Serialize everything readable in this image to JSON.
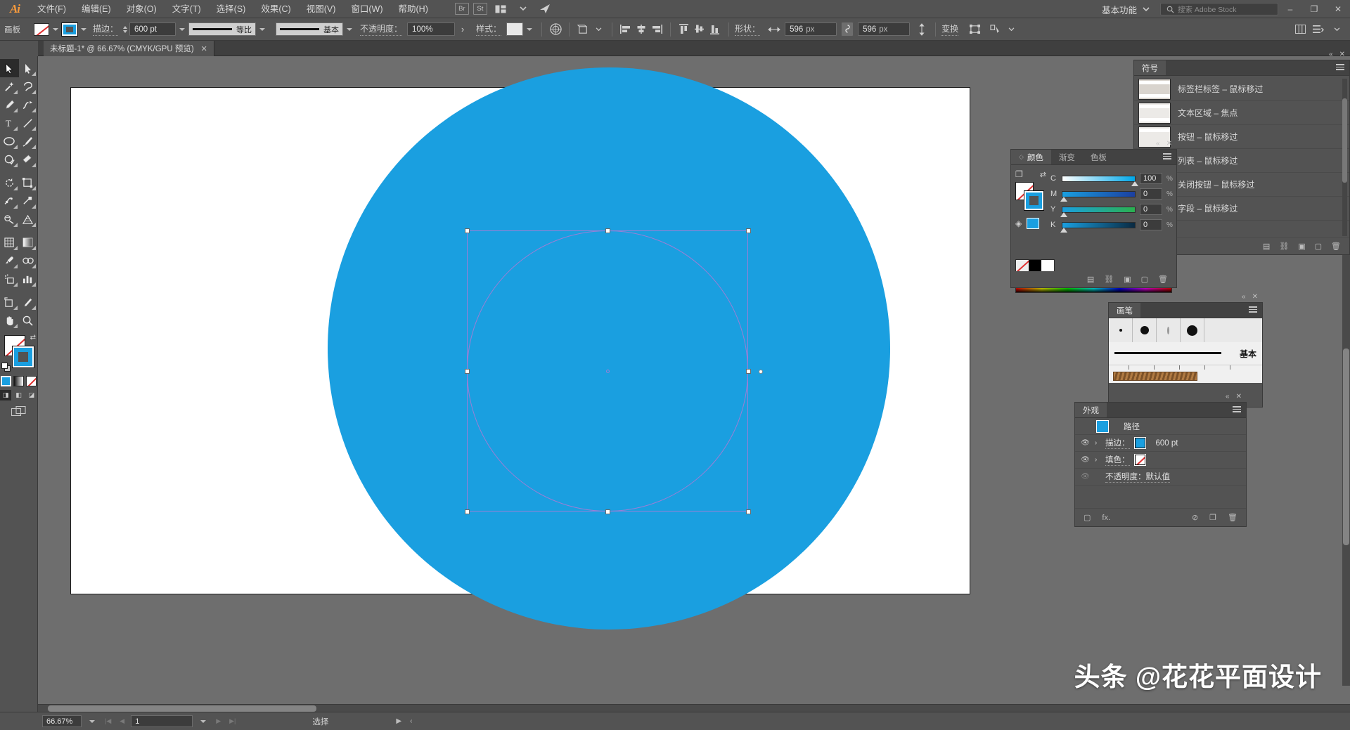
{
  "app": {
    "name": "Ai",
    "logo_color": "#f79a3c"
  },
  "menubar": {
    "items": [
      {
        "label": "文件(F)"
      },
      {
        "label": "编辑(E)"
      },
      {
        "label": "对象(O)"
      },
      {
        "label": "文字(T)"
      },
      {
        "label": "选择(S)"
      },
      {
        "label": "效果(C)"
      },
      {
        "label": "视图(V)"
      },
      {
        "label": "窗口(W)"
      },
      {
        "label": "帮助(H)"
      }
    ],
    "bridge_label": "Br",
    "stock_label": "St",
    "arrange_icon": "arrange-documents-icon",
    "sync_icon": "sync-settings-icon",
    "workspace": "基本功能",
    "search_placeholder": "搜索 Adobe Stock",
    "window_buttons": {
      "minimize": "–",
      "maximize": "❐",
      "close": "✕"
    }
  },
  "controlbar": {
    "fill_label": "填色",
    "stroke_swatch_label": "描边颜色",
    "stroke_label": "描边：",
    "stroke_weight": "600 pt",
    "profile_label": "等比",
    "brush_label": "基本",
    "opacity_label": "不透明度：",
    "opacity_value": "100%",
    "style_label": "样式：",
    "recolor_icon": "recolor-artwork-icon",
    "transform_perspective_icon": "perspective-grid-icon",
    "align_left_icon": "align-left-icon",
    "align_center_h_icon": "align-center-horizontal-icon",
    "align_right_icon": "align-right-icon",
    "align_top_icon": "align-top-icon",
    "align_center_v_icon": "align-center-vertical-icon",
    "align_bottom_icon": "align-bottom-icon",
    "shape_label": "形状：",
    "width_value": "596",
    "width_unit": "px",
    "height_value": "596",
    "height_unit": "px",
    "link_icon": "constrain-proportions-icon",
    "transform_label": "变换",
    "envelope_icon": "envelope-distort-icon",
    "select_similar_icon": "select-similar-objects-icon",
    "arrange_doc_icon": "arrange-documents-icon",
    "panel_menu_icon": "panel-menu-icon"
  },
  "document": {
    "tab_title": "未标题-1* @ 66.67% (CMYK/GPU 预览)",
    "close_label": "✕",
    "panel_label": "画板"
  },
  "toolbar": {
    "tools": [
      {
        "name": "selection-tool",
        "active": true
      },
      {
        "name": "direct-selection-tool",
        "active": false
      },
      {
        "name": "magic-wand-tool",
        "active": false
      },
      {
        "name": "lasso-tool",
        "active": false
      },
      {
        "name": "pen-tool",
        "active": false
      },
      {
        "name": "curvature-tool",
        "active": false
      },
      {
        "name": "type-tool",
        "active": false
      },
      {
        "name": "line-segment-tool",
        "active": false
      },
      {
        "name": "ellipse-tool",
        "active": false
      },
      {
        "name": "paintbrush-tool",
        "active": false
      },
      {
        "name": "shaper-tool",
        "active": false
      },
      {
        "name": "eraser-tool",
        "active": false
      },
      {
        "name": "rotate-tool",
        "active": false
      },
      {
        "name": "scale-tool",
        "active": false
      },
      {
        "name": "width-tool",
        "active": false
      },
      {
        "name": "free-transform-tool",
        "active": false
      },
      {
        "name": "shape-builder-tool",
        "active": false
      },
      {
        "name": "perspective-grid-tool",
        "active": false
      },
      {
        "name": "mesh-tool",
        "active": false
      },
      {
        "name": "gradient-tool",
        "active": false
      },
      {
        "name": "eyedropper-tool",
        "active": false
      },
      {
        "name": "blend-tool",
        "active": false
      },
      {
        "name": "symbol-sprayer-tool",
        "active": false
      },
      {
        "name": "column-graph-tool",
        "active": false
      },
      {
        "name": "artboard-tool",
        "active": false
      },
      {
        "name": "slice-tool",
        "active": false
      },
      {
        "name": "hand-tool",
        "active": false
      },
      {
        "name": "zoom-tool",
        "active": false
      }
    ],
    "fill_color": "none",
    "stroke_color": "#1a9fe0",
    "swap_icon": "swap-fill-stroke-icon",
    "default_icon": "default-fill-stroke-icon",
    "color_modes": [
      "color-mode-solid",
      "color-mode-gradient",
      "color-mode-none"
    ],
    "draw_modes": [
      "draw-normal",
      "draw-behind",
      "draw-inside"
    ],
    "screen_mode_icon": "screen-mode-icon"
  },
  "canvas": {
    "zoom": "66.67%",
    "shape_fill": "#1a9fe0",
    "selection_color": "#9a7fd6",
    "artboard_background": "#ffffff"
  },
  "panels": {
    "symbols": {
      "title": "符号",
      "tab_name": "符号",
      "items": [
        {
          "label": "标签栏标签 – 鼠标移过",
          "thumb": "tabbar-tab"
        },
        {
          "label": "文本区域 – 焦点",
          "thumb": "text-area"
        },
        {
          "label": "按钮 – 鼠标移过",
          "thumb": "button"
        },
        {
          "label": "列表 – 鼠标移过",
          "thumb": "list"
        },
        {
          "label": "关闭按钮 – 鼠标移过",
          "thumb": "close-button"
        },
        {
          "label": "字段 – 鼠标移过",
          "thumb": "field"
        }
      ],
      "footer_icons": [
        "symbol-libraries-icon",
        "symbol-link-icon",
        "place-symbol-icon",
        "new-symbol-icon",
        "delete-symbol-icon"
      ]
    },
    "color": {
      "tabs": [
        {
          "label": "颜色",
          "active": true
        },
        {
          "label": "渐变",
          "active": false
        },
        {
          "label": "色板",
          "active": false
        }
      ],
      "sliders": [
        {
          "label": "C",
          "value": "100",
          "unit": "%",
          "pos": 100
        },
        {
          "label": "M",
          "value": "0",
          "unit": "%",
          "pos": 0
        },
        {
          "label": "Y",
          "value": "0",
          "unit": "%",
          "pos": 0
        },
        {
          "label": "K",
          "value": "0",
          "unit": "%",
          "pos": 0
        }
      ],
      "fill_color": "none",
      "stroke_color": "#1a9fe0",
      "none_swatch": "none",
      "black_swatch": "#000000",
      "white_swatch": "#ffffff"
    },
    "brushes": {
      "title": "画笔",
      "basic_label": "基本",
      "presets": [
        "brush-dot-tiny",
        "brush-dot-small",
        "brush-calligraphic",
        "brush-dot-large"
      ]
    },
    "appearance": {
      "title": "外观",
      "rows": [
        {
          "type": "object",
          "label": "路径",
          "swatch": "#1a9fe0"
        },
        {
          "type": "stroke",
          "label": "描边：",
          "swatch": "#1a9fe0",
          "value": "600 pt",
          "eye": true
        },
        {
          "type": "fill",
          "label": "填色：",
          "swatch": "none",
          "value": "",
          "eye": true
        },
        {
          "type": "opacity",
          "label": "不透明度：默认值",
          "eye": false
        }
      ],
      "footer_icons": [
        "add-new-stroke-icon",
        "add-new-fill-icon",
        "add-effect-icon",
        "clear-appearance-icon",
        "duplicate-item-icon",
        "delete-item-icon"
      ]
    }
  },
  "statusbar": {
    "zoom": "66.67%",
    "page": "1",
    "status_text": "选择",
    "first_icon": "first-artboard-icon",
    "prev_icon": "previous-artboard-icon",
    "next_icon": "next-artboard-icon",
    "last_icon": "last-artboard-icon"
  },
  "watermark": {
    "text": "头条 @花花平面设计"
  }
}
